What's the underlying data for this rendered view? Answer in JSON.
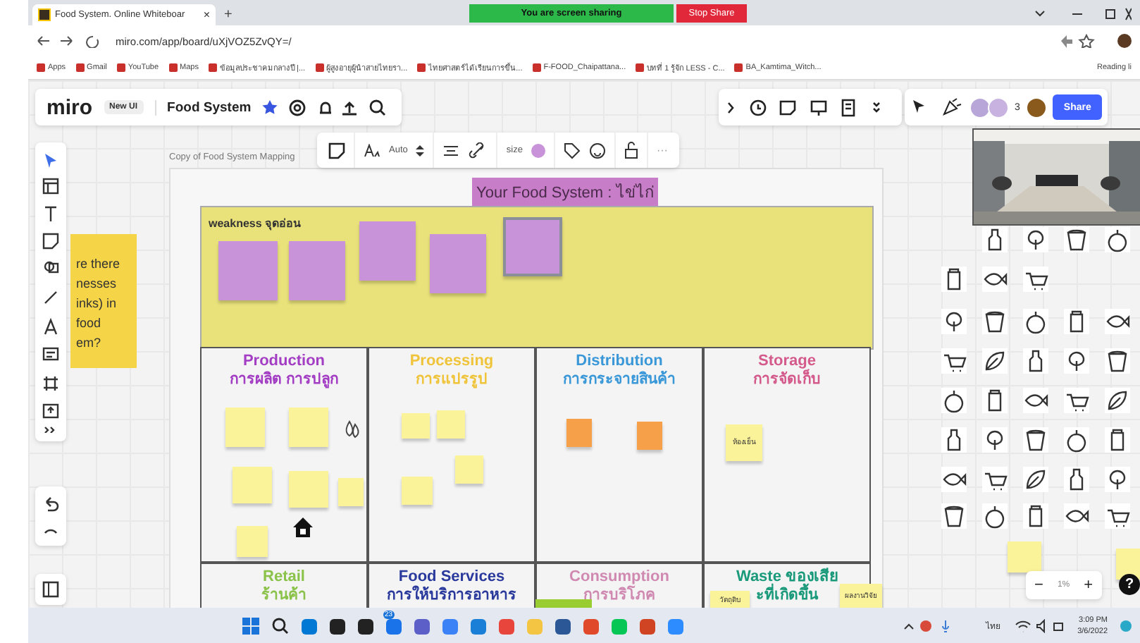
{
  "browser": {
    "tab_title": "Food System. Online Whiteboar",
    "tab_close": "×",
    "new_tab": "+",
    "sharing_banner": "You are screen sharing",
    "stop_share": "Stop Share",
    "url": "miro.com/app/board/uXjVOZ5ZvQY=/",
    "bookmarks": [
      "Apps",
      "Gmail",
      "YouTube",
      "Maps",
      "ข้อมูลประชาคมกลางปี |...",
      "ผู้สูงอายุผู้นำสายไทยรา...",
      "ไทยศาสตร์ได้เรียนการขึ้น...",
      "F-FOOD_Chaipattana...",
      "บทที่ 1 รู้จัก LESS - C...",
      "BA_Kamtima_Witch..."
    ],
    "reading_list": "Reading li"
  },
  "toolbar": {
    "logo": "miro",
    "badge": "New UI",
    "board_name": "Food System",
    "collaborator_count": "3",
    "share": "Share"
  },
  "frame_caption": "Copy of  Food System Mapping",
  "context_toolbar": {
    "font_size": "Auto",
    "size_label": "size",
    "more": "···"
  },
  "side_note": [
    "re there",
    "nesses",
    "inks) in",
    "food",
    "em?"
  ],
  "board": {
    "title": "Your Food System : ไข่ไก่",
    "weakness": {
      "label": "weakness จุดอ่อน",
      "stickies": [
        {
          "color": "#c893d8",
          "selected": false
        },
        {
          "color": "#c893d8",
          "selected": false
        },
        {
          "color": "#c893d8",
          "selected": false
        },
        {
          "color": "#c893d8",
          "selected": false
        },
        {
          "color": "#c893d8",
          "selected": true
        }
      ]
    },
    "sections": [
      {
        "title": "Production",
        "subtitle": "การผลิต การปลูก",
        "color": "#a23dc4",
        "stickies": [
          {
            "color": "#fbf39a"
          },
          {
            "color": "#fbf39a"
          },
          {
            "color": "#fbf39a"
          },
          {
            "color": "#fbf39a"
          },
          {
            "color": "#fbf39a"
          },
          {
            "color": "#fbf39a"
          }
        ]
      },
      {
        "title": "Processing",
        "subtitle": "การแปรรูป",
        "color": "#f0c43a",
        "stickies": [
          {
            "color": "#fbf39a"
          },
          {
            "color": "#fbf39a"
          },
          {
            "color": "#fbf39a"
          },
          {
            "color": "#fbf39a"
          }
        ]
      },
      {
        "title": "Distribution",
        "subtitle": "การกระจายสินค้า",
        "color": "#3a98d8",
        "stickies": [
          {
            "color": "#f7a04a"
          },
          {
            "color": "#f7a04a"
          }
        ]
      },
      {
        "title": "Storage",
        "subtitle": "การจัดเก็บ",
        "color": "#d45a8c",
        "stickies": [
          {
            "color": "#fbf39a",
            "text": "ห้องเย็น"
          }
        ]
      },
      {
        "title": "Retail",
        "subtitle": "ร้านค้า",
        "color": "#8bc34a"
      },
      {
        "title": "Food Services",
        "subtitle": "การให้บริการอาหาร",
        "color": "#2a3a9c"
      },
      {
        "title": "Consumption",
        "subtitle": "การบริโภค",
        "color": "#d08ab2"
      },
      {
        "title": "Waste ของเสีย",
        "subtitle": "ะที่เกิดขึ้น",
        "color": "#1a9a7a",
        "stickies": [
          {
            "color": "#fbf39a",
            "text": "วัตถุดิบ"
          },
          {
            "color": "#fbf39a",
            "text": "ผลงานวิจัย"
          }
        ]
      }
    ]
  },
  "zoom": {
    "minus": "−",
    "level": "1%",
    "plus": "+",
    "help": "?"
  },
  "taskbar": {
    "badge": "23",
    "language": "ไทย",
    "time": "3:09 PM",
    "date": "3/6/2022"
  }
}
